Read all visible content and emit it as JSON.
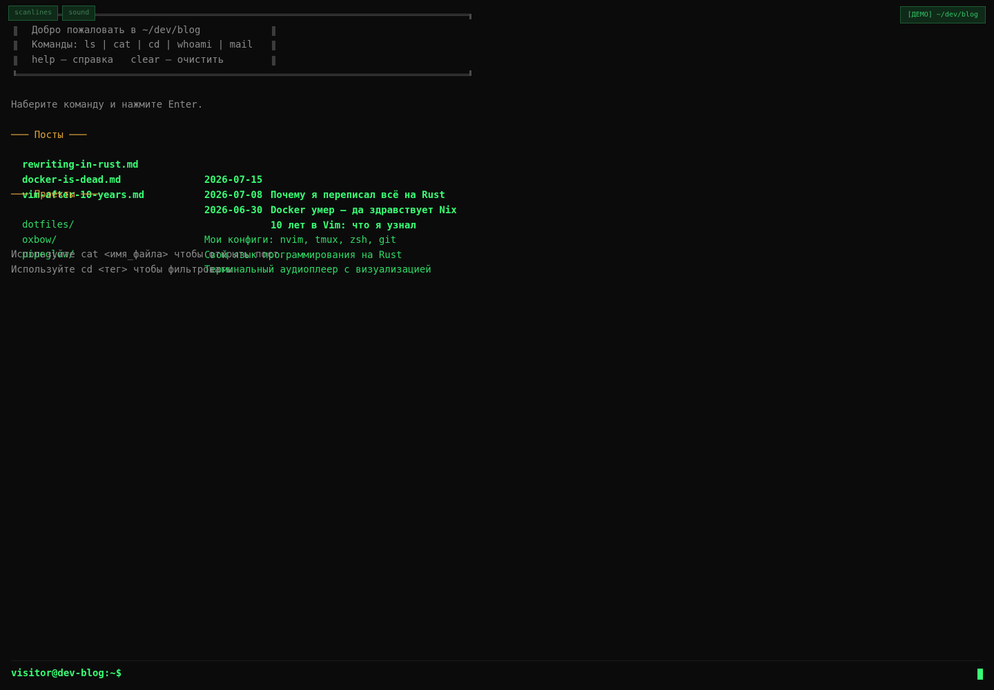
{
  "toolbar": {
    "scanlines_label": "scanlines",
    "sound_label": "sound"
  },
  "badge": "[ДЕМО] ~/dev/blog",
  "welcome": {
    "line1": "Добро пожаловать в ~/dev/blog",
    "line2": "Команды: ls | cat | cd | whoami | mail",
    "line3": "help — справка   clear — очистить"
  },
  "hint": "Наберите команду и нажмите Enter.",
  "sections": {
    "posts": "─── Посты ───",
    "projects": "─── Проекты ───"
  },
  "posts": [
    {
      "file": "rewriting-in-rust.md",
      "date": "2026-07-15",
      "title": "Почему я переписал всё на Rust"
    },
    {
      "file": "docker-is-dead.md",
      "date": "2026-07-08",
      "title": "Docker умер — да здравствует Nix"
    },
    {
      "file": "vim-after-10-years.md",
      "date": "2026-06-30",
      "title": "10 лет в Vim: что я узнал"
    }
  ],
  "projects": [
    {
      "name": "dotfiles/",
      "desc": "Мои конфиги: nvim, tmux, zsh, git"
    },
    {
      "name": "oxbow/",
      "desc": "Свой язык программирования на Rust"
    },
    {
      "name": "pipeglow/",
      "desc": "Терминальный аудиоплеер с визуализацией"
    }
  ],
  "notes": {
    "cat": "Используйте cat <имя_файла> чтобы открыть пост.",
    "cd": "Используйте cd <тег> чтобы фильтровать."
  },
  "prompt": "visitor@dev-blog:~$",
  "input_value": ""
}
